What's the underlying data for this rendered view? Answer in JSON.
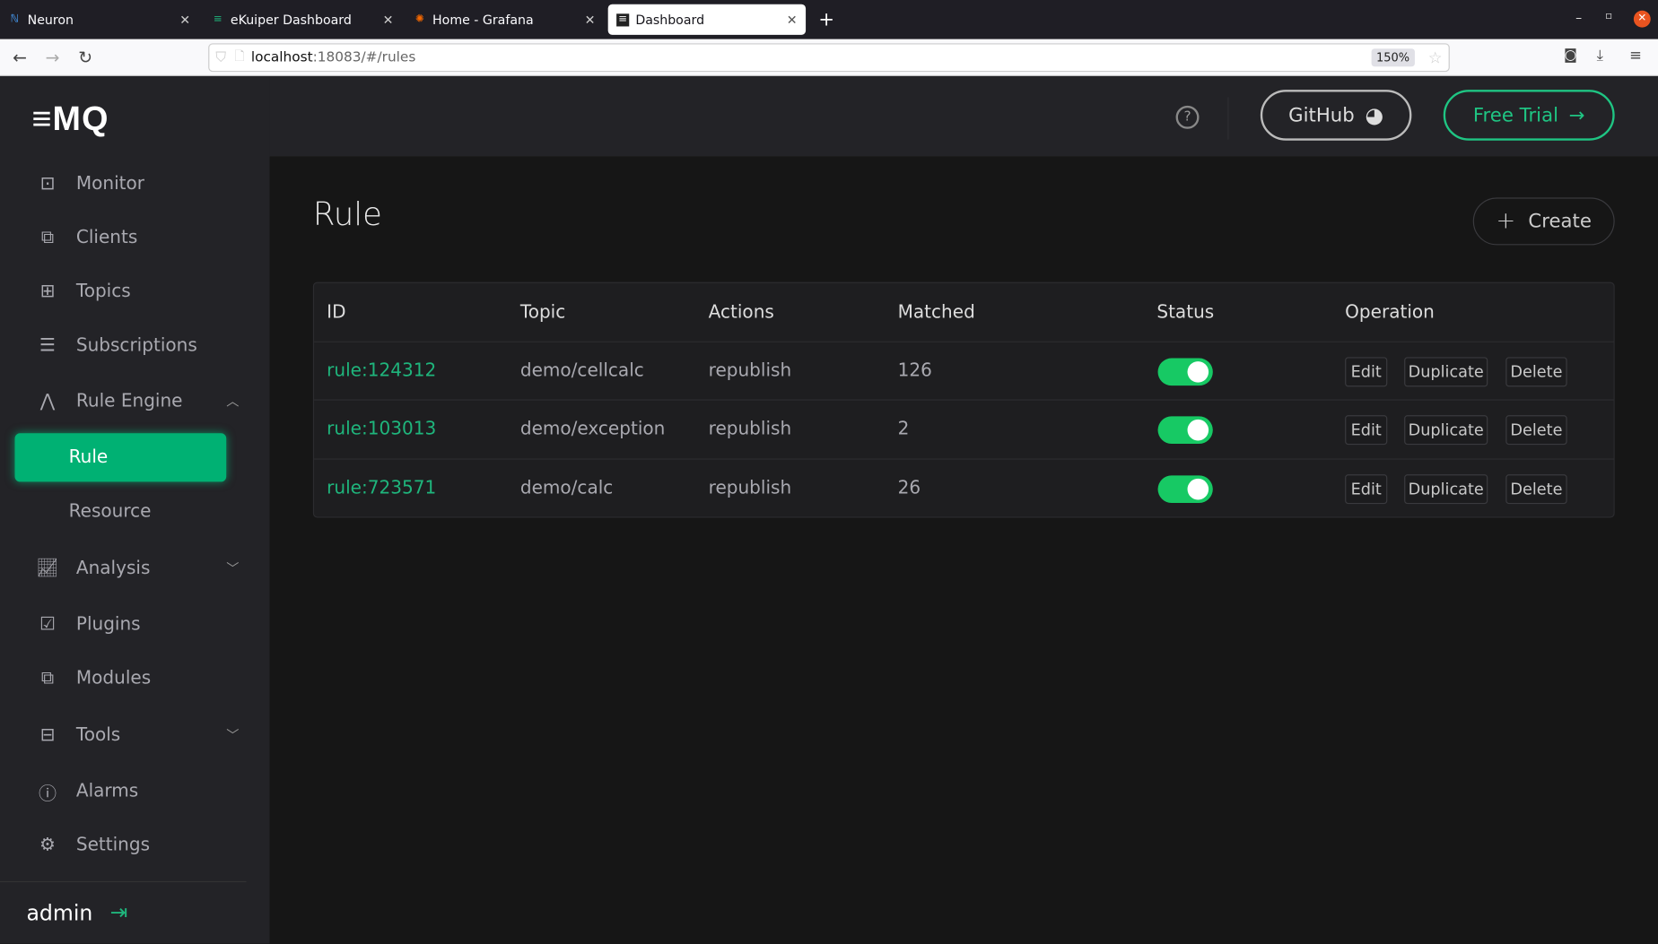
{
  "browser": {
    "tabs": [
      {
        "label": "Neuron"
      },
      {
        "label": "eKuiper Dashboard"
      },
      {
        "label": "Home - Grafana"
      },
      {
        "label": "Dashboard"
      }
    ],
    "url_host": "localhost",
    "url_rest": ":18083/#/rules",
    "zoom": "150%"
  },
  "sidebar": {
    "logo": "≡MQ",
    "items": [
      {
        "label": "Monitor"
      },
      {
        "label": "Clients"
      },
      {
        "label": "Topics"
      },
      {
        "label": "Subscriptions"
      },
      {
        "label": "Rule Engine"
      },
      {
        "label": "Rule"
      },
      {
        "label": "Resource"
      },
      {
        "label": "Analysis"
      },
      {
        "label": "Plugins"
      },
      {
        "label": "Modules"
      },
      {
        "label": "Tools"
      },
      {
        "label": "Alarms"
      },
      {
        "label": "Settings"
      }
    ],
    "user": "admin"
  },
  "header": {
    "github": "GitHub",
    "free_trial": "Free Trial",
    "help": "?"
  },
  "main": {
    "title": "Rule",
    "create": "Create",
    "columns": [
      "ID",
      "Topic",
      "Actions",
      "Matched",
      "Status",
      "Operation"
    ],
    "rows": [
      {
        "id": "rule:124312",
        "topic": "demo/cellcalc",
        "actions": "republish",
        "matched": "126",
        "enabled": true
      },
      {
        "id": "rule:103013",
        "topic": "demo/exception",
        "actions": "republish",
        "matched": "2",
        "enabled": true
      },
      {
        "id": "rule:723571",
        "topic": "demo/calc",
        "actions": "republish",
        "matched": "26",
        "enabled": true
      }
    ],
    "ops": {
      "edit": "Edit",
      "duplicate": "Duplicate",
      "delete": "Delete"
    }
  },
  "colors": {
    "accent": "#00b173",
    "toggle": "#17c964",
    "link": "#1fb57c"
  }
}
